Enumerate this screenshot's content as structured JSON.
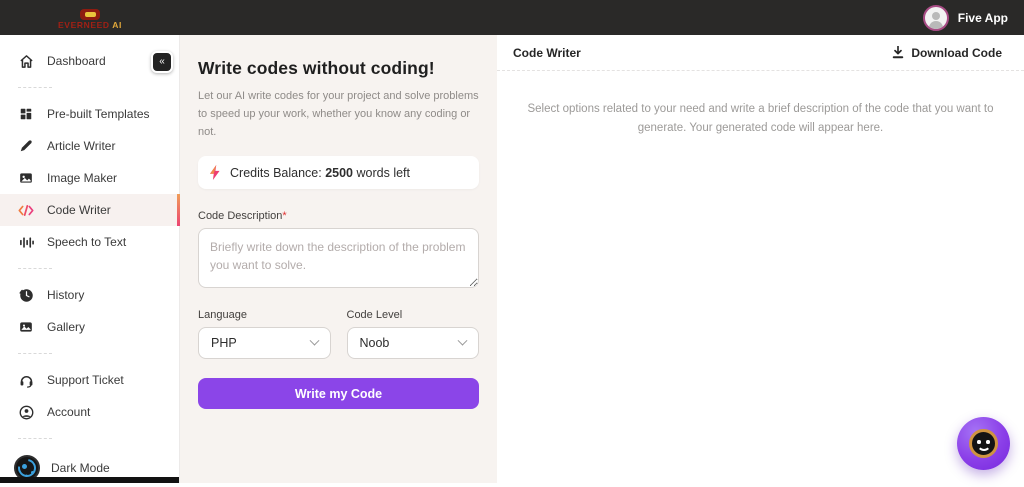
{
  "topbar": {
    "brand": "EVERNEED",
    "brand_accent": "AI",
    "user_name": "Five App"
  },
  "sidebar": {
    "collapse_glyph": "«",
    "items": [
      {
        "label": "Dashboard",
        "icon": "home-icon",
        "active": false
      },
      {
        "label": "Pre-built Templates",
        "icon": "templates-icon",
        "active": false
      },
      {
        "label": "Article Writer",
        "icon": "pen-icon",
        "active": false
      },
      {
        "label": "Image Maker",
        "icon": "image-icon",
        "active": false
      },
      {
        "label": "Code Writer",
        "icon": "code-icon",
        "active": true
      },
      {
        "label": "Speech to Text",
        "icon": "waveform-icon",
        "active": false
      },
      {
        "label": "History",
        "icon": "history-icon",
        "active": false
      },
      {
        "label": "Gallery",
        "icon": "gallery-icon",
        "active": false
      },
      {
        "label": "Support Ticket",
        "icon": "headset-icon",
        "active": false
      },
      {
        "label": "Account",
        "icon": "person-icon",
        "active": false
      },
      {
        "label": "Dark Mode",
        "icon": "moon-icon",
        "active": false
      }
    ]
  },
  "form_panel": {
    "title": "Write codes without coding!",
    "subtitle": "Let our AI write codes for your project and solve problems to speed up your work, whether you know any coding or not.",
    "credits": {
      "label": "Credits Balance:",
      "value": "2500",
      "suffix": "words left"
    },
    "description_label": "Code Description",
    "required_mark": "*",
    "description_placeholder": "Briefly write down the description of the problem you want to solve.",
    "language_label": "Language",
    "language_value": "PHP",
    "code_level_label": "Code Level",
    "code_level_value": "Noob",
    "submit_label": "Write my Code"
  },
  "output_panel": {
    "title": "Code Writer",
    "download_label": "Download Code",
    "placeholder": "Select options related to your need and write a brief description of the code that you want to generate. Your generated code will appear here."
  },
  "colors": {
    "topbar_bg": "#2a2928",
    "brand_red": "#a02015",
    "brand_yellow": "#e2a93b",
    "panel_beige": "#f7f3f0",
    "accent_purple": "#8b45e8",
    "active_gradient_top": "#f09d57",
    "active_gradient_bottom": "#ec4472",
    "darkmode_blue": "#3ba0dc"
  }
}
